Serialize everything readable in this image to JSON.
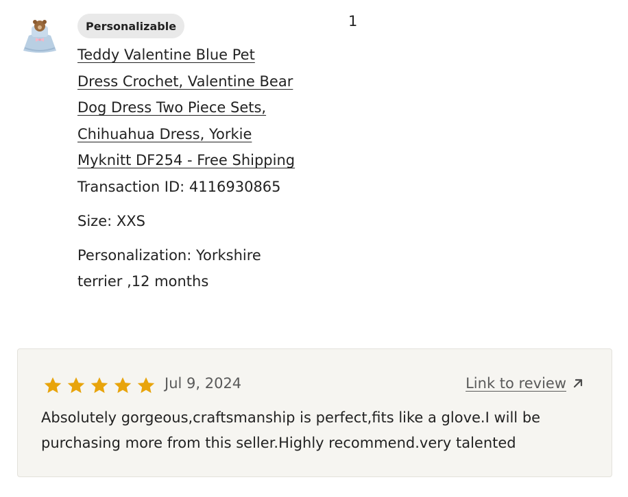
{
  "product": {
    "thumbnail_icon": "teddy-bear-dog-dress-thumbnail",
    "badge": "Personalizable",
    "title": "Teddy Valentine Blue Pet Dress Crochet, Valentine Bear Dog Dress Two Piece Sets, Chihuahua Dress, Yorkie Myknitt DF254 - Free Shipping",
    "transaction_id": "Transaction ID: 4116930865",
    "size": "Size: XXS",
    "personalization": "Personalization: Yorkshire terrier ,12 months",
    "quantity": "1"
  },
  "review": {
    "rating": 5,
    "max_rating": 5,
    "star_color": "#e8a40c",
    "date": "Jul 9, 2024",
    "link_label": "Link to review",
    "link_icon": "arrow-up-right-icon",
    "text": "Absolutely gorgeous,craftsmanship is perfect,fits like a glove.I will be purchasing more from this seller.Highly recommend.very talented"
  }
}
